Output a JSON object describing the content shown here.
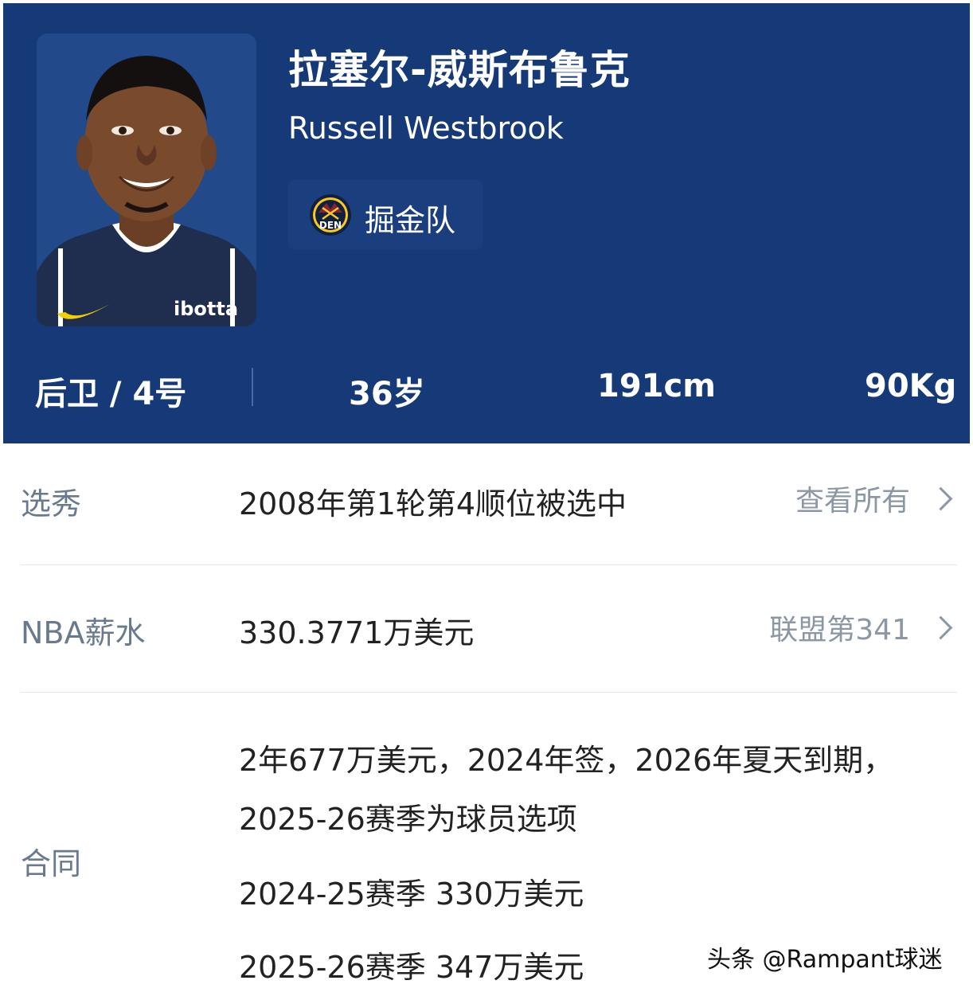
{
  "player": {
    "name_cn": "拉塞尔-威斯布鲁克",
    "name_en": "Russell Westbrook",
    "team": {
      "name": "掘金队",
      "logo_text": "DEN",
      "logo_icon": "nuggets-logo-icon"
    },
    "jersey_sponsor": "ibotta",
    "stats": {
      "position": "后卫 / 4号",
      "age": "36岁",
      "height": "191cm",
      "weight": "90Kg"
    }
  },
  "details": {
    "draft": {
      "label": "选秀",
      "value": "2008年第1轮第4顺位被选中",
      "link": "查看所有"
    },
    "salary": {
      "label": "NBA薪水",
      "value": "330.3771万美元",
      "link": "联盟第341"
    },
    "contract": {
      "label": "合同",
      "line1": "2年677万美元，2024年签，2026年夏天到期，",
      "line2": "2025-26赛季为球员选项",
      "line3": "2024-25赛季 330万美元",
      "line4": "2025-26赛季 347万美元"
    }
  },
  "watermark": "头条 @Rampant球迷",
  "colors": {
    "header_bg": "#163a78",
    "label": "#6a7a8e",
    "value": "#222222",
    "link": "#8c97a6"
  }
}
